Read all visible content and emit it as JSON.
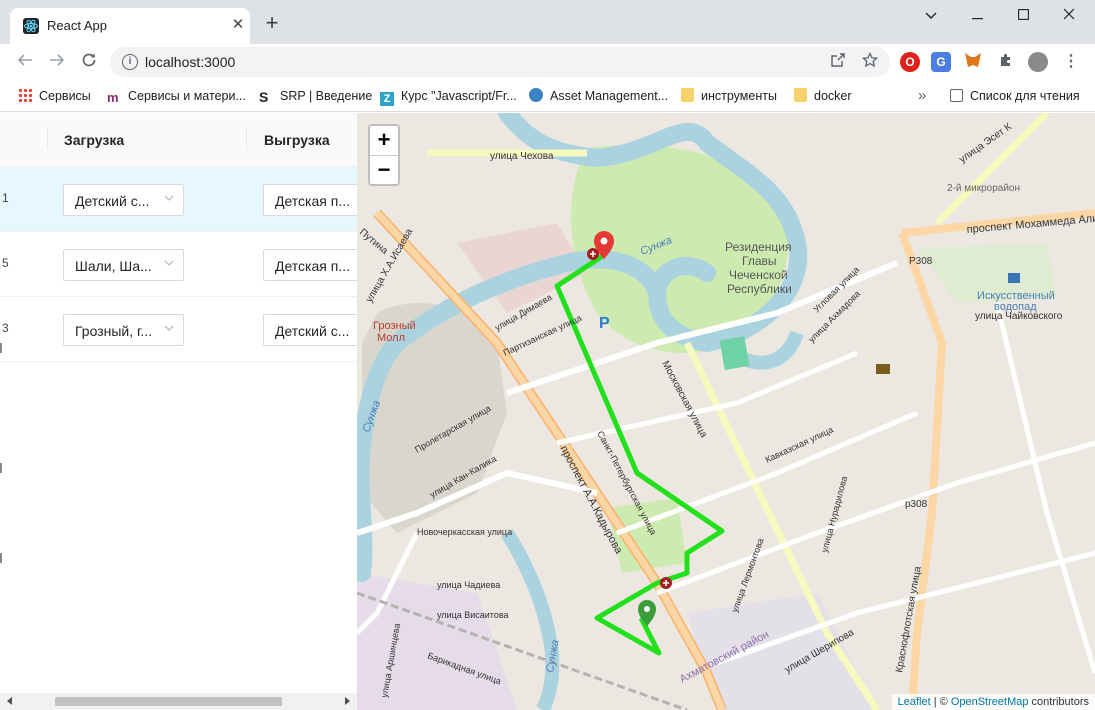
{
  "browser": {
    "tab_title": "React App",
    "url": "localhost:3000",
    "new_tab_symbol": "+",
    "window_controls": [
      "chevron-down-icon",
      "minimize-icon",
      "maximize-icon",
      "close-icon"
    ]
  },
  "bookmarks": {
    "items": [
      {
        "label": "Сервисы",
        "icon": "apps-grid-icon"
      },
      {
        "label": "Сервисы и матери...",
        "icon": "m-logo-icon"
      },
      {
        "label": "SRP | Введение",
        "icon": "s-logo-icon"
      },
      {
        "label": "Курс \"Javascript/Fr...",
        "icon": "z-logo-icon"
      },
      {
        "label": "Asset Management...",
        "icon": "globe-icon"
      },
      {
        "label": "инструменты",
        "icon": "folder-icon"
      },
      {
        "label": "docker",
        "icon": "folder-icon"
      }
    ],
    "more": "»",
    "reading_list": "Список для чтения"
  },
  "table": {
    "columns": [
      "Загрузка",
      "Выгрузка"
    ],
    "rows": [
      {
        "no": "1",
        "loading": "Детский с...",
        "unloading": "Детская п...",
        "selected": true
      },
      {
        "no": "5",
        "loading": "Шали, Ша...",
        "unloading": "Детская п...",
        "selected": false
      },
      {
        "no": "3",
        "loading": "Грозный, г...",
        "unloading": "Детский с...",
        "selected": false
      }
    ]
  },
  "map": {
    "zoom_in": "+",
    "zoom_out": "−",
    "attribution": {
      "leaflet": "Leaflet",
      "sep": " | © ",
      "osm": "OpenStreetMap",
      "suffix": " contributors"
    },
    "route_color": "#22e01b",
    "labels": {
      "chekhova": "улица Чехова",
      "residence": [
        "Резиденция",
        "Главы",
        "Чеченской",
        "Республики"
      ],
      "sunzha": "Сунжа",
      "sunzha2": "Сунжа",
      "sunzha3": "Сунжа",
      "kadyrova": "проспект А.А.Кадырова",
      "moskovskaya": "Московская улица",
      "p308": "Р308",
      "p308b": "р308",
      "waterfall": [
        "Искусственный",
        "водопад"
      ],
      "grozny_mall": [
        "Грозный",
        "Молл"
      ],
      "district": "Ахматовский район",
      "sheripova": "улица Шерипова",
      "krasnoflotskaya": "Краснофлотская улица",
      "mahomed": "проспект Мохаммеда Али",
      "chaikovskogo": "улица Чайковского",
      "micro": "2-й микрорайон",
      "esset": "улица Эсет К",
      "isaeva": "улица Х.А.Исаева",
      "putina": "Путина",
      "dimaeva": "улица Димаева",
      "partizanskaya": "Партизанская улица",
      "kan_kalika": "улица Кан-Калика",
      "chadieva": "улица Чадиева",
      "visaitova": "улица Висаитова",
      "barikadnaya": "Барикадная улица",
      "arshinceva": "улица Аршинцева",
      "novocherk": "Новочеркасская улица",
      "proletar": "Пролетарская улица",
      "spb": "Санкт-Петербургская улица",
      "kavkaz": "Кавказская улица",
      "akhmadova": "улица Ахмадова",
      "ugl": "Угловая улица",
      "nuradilova": "улица Нурадилова",
      "lermontova": "улица Лермонтова",
      "parking": "P"
    }
  }
}
